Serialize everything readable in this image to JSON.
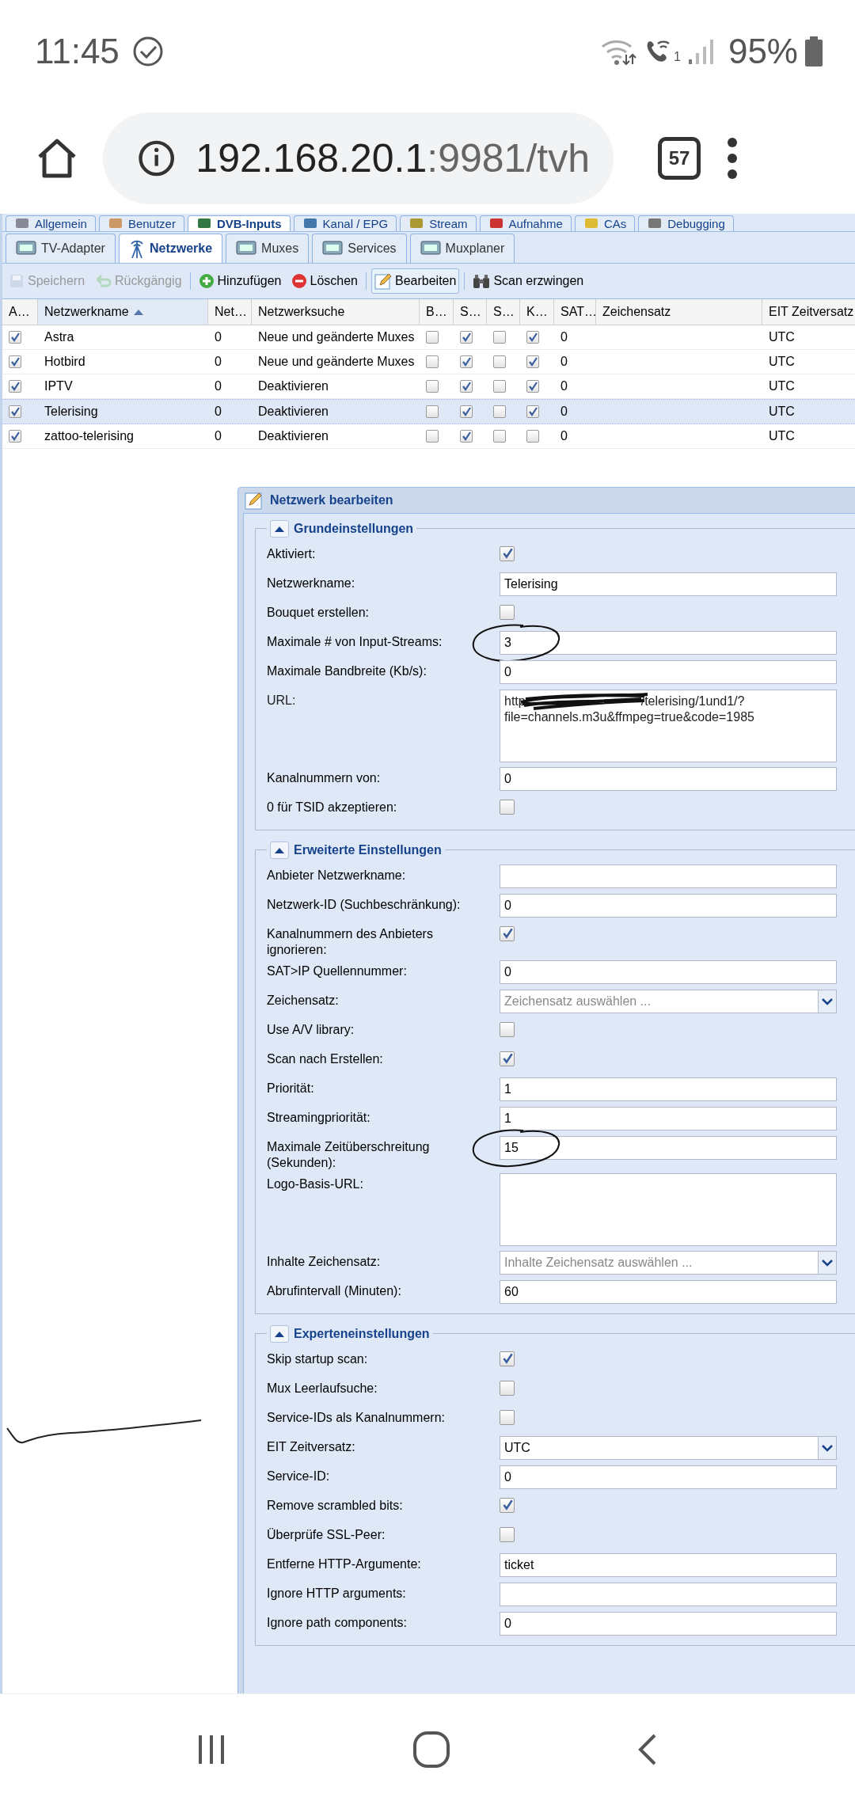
{
  "status_bar": {
    "time": "11:45",
    "sim_label": "1",
    "battery": "95%"
  },
  "browser": {
    "url_host": "192.168.20.1",
    "url_rest": ":9981/tvh",
    "tab_count": "57"
  },
  "main_tabs": [
    {
      "label": "Allgemein",
      "selected": false
    },
    {
      "label": "Benutzer",
      "selected": false
    },
    {
      "label": "DVB-Inputs",
      "selected": true
    },
    {
      "label": "Kanal / EPG",
      "selected": false
    },
    {
      "label": "Stream",
      "selected": false
    },
    {
      "label": "Aufnahme",
      "selected": false
    },
    {
      "label": "CAs",
      "selected": false
    },
    {
      "label": "Debugging",
      "selected": false
    }
  ],
  "sub_tabs": [
    {
      "label": "TV-Adapter",
      "selected": false
    },
    {
      "label": "Netzwerke",
      "selected": true
    },
    {
      "label": "Muxes",
      "selected": false
    },
    {
      "label": "Services",
      "selected": false
    },
    {
      "label": "Muxplaner",
      "selected": false
    }
  ],
  "toolbar": [
    {
      "label": "Speichern",
      "disabled": true,
      "pressed": false
    },
    {
      "label": "Rückgängig",
      "disabled": true,
      "pressed": false
    },
    {
      "label": "Hinzufügen",
      "disabled": false,
      "pressed": false
    },
    {
      "label": "Löschen",
      "disabled": false,
      "pressed": false
    },
    {
      "label": "Bearbeiten",
      "disabled": false,
      "pressed": true
    },
    {
      "label": "Scan erzwingen",
      "disabled": false,
      "pressed": false
    }
  ],
  "table": {
    "columns": [
      {
        "label": "A…",
        "kind": "check",
        "sorted": false
      },
      {
        "label": "Netzwerkname",
        "kind": "text",
        "sorted": true
      },
      {
        "label": "Net…",
        "kind": "text",
        "sorted": false
      },
      {
        "label": "Netzwerksuche",
        "kind": "text",
        "sorted": false
      },
      {
        "label": "B…",
        "kind": "check",
        "sorted": false
      },
      {
        "label": "S…",
        "kind": "check",
        "sorted": false
      },
      {
        "label": "S…",
        "kind": "check",
        "sorted": false
      },
      {
        "label": "K…",
        "kind": "check",
        "sorted": false
      },
      {
        "label": "SAT…",
        "kind": "text",
        "sorted": false
      },
      {
        "label": "Zeichensatz",
        "kind": "text",
        "sorted": false
      },
      {
        "label": "EIT Zeitversatz",
        "kind": "text",
        "sorted": false
      }
    ],
    "rows": [
      {
        "selected": false,
        "cells": [
          {
            "checked": true
          },
          {
            "text": "Astra"
          },
          {
            "text": "0"
          },
          {
            "text": "Neue und geänderte Muxes"
          },
          {
            "checked": false
          },
          {
            "checked": true
          },
          {
            "checked": false
          },
          {
            "checked": true
          },
          {
            "text": "0"
          },
          {},
          {
            "text": "UTC"
          }
        ]
      },
      {
        "selected": false,
        "cells": [
          {
            "checked": true
          },
          {
            "text": "Hotbird"
          },
          {
            "text": "0"
          },
          {
            "text": "Neue und geänderte Muxes"
          },
          {
            "checked": false
          },
          {
            "checked": true
          },
          {
            "checked": false
          },
          {
            "checked": true
          },
          {
            "text": "0"
          },
          {},
          {
            "text": "UTC"
          }
        ]
      },
      {
        "selected": false,
        "cells": [
          {
            "checked": true
          },
          {
            "text": "IPTV"
          },
          {
            "text": "0"
          },
          {
            "text": "Deaktivieren"
          },
          {
            "checked": false
          },
          {
            "checked": true
          },
          {
            "checked": false
          },
          {
            "checked": true
          },
          {
            "text": "0"
          },
          {},
          {
            "text": "UTC"
          }
        ]
      },
      {
        "selected": true,
        "cells": [
          {
            "checked": true
          },
          {
            "text": "Telerising"
          },
          {
            "text": "0"
          },
          {
            "text": "Deaktivieren"
          },
          {
            "checked": false
          },
          {
            "checked": true
          },
          {
            "checked": false
          },
          {
            "checked": true
          },
          {
            "text": "0"
          },
          {},
          {
            "text": "UTC"
          }
        ]
      },
      {
        "selected": false,
        "cells": [
          {
            "checked": true
          },
          {
            "text": "zattoo-telerising"
          },
          {
            "text": "0"
          },
          {
            "text": "Deaktivieren"
          },
          {
            "checked": false
          },
          {
            "checked": true
          },
          {
            "checked": false
          },
          {
            "checked": false
          },
          {
            "text": "0"
          },
          {},
          {
            "text": "UTC"
          }
        ]
      }
    ]
  },
  "edit_window": {
    "title": "Netzwerk bearbeiten",
    "sections": [
      {
        "title": "Grundeinstellungen",
        "expanded": true,
        "fields": [
          {
            "kind": "checkbox",
            "label": "Aktiviert:",
            "checked": true
          },
          {
            "kind": "text",
            "label": "Netzwerkname:",
            "value": "Telerising"
          },
          {
            "kind": "checkbox",
            "label": "Bouquet erstellen:",
            "checked": false
          },
          {
            "kind": "text",
            "label": "Maximale # von Input-Streams:",
            "value": "3",
            "circled": true
          },
          {
            "kind": "text",
            "label": "Maximale Bandbreite (Kb/s):",
            "value": "0"
          },
          {
            "kind": "url",
            "label": "URL:",
            "value_parts": [
              "http",
              "/telerising/1und1/?",
              "file=channels.m3u&ffmpeg=true&code=1985"
            ]
          },
          {
            "kind": "text",
            "label": "Kanalnummern von:",
            "value": "0"
          },
          {
            "kind": "checkbox",
            "label": "0 für TSID akzeptieren:",
            "checked": false
          }
        ]
      },
      {
        "title": "Erweiterte Einstellungen",
        "expanded": true,
        "fields": [
          {
            "kind": "text",
            "label": "Anbieter Netzwerkname:"
          },
          {
            "kind": "text",
            "label": "Netzwerk-ID (Suchbeschränkung):",
            "value": "0"
          },
          {
            "kind": "checkbox",
            "label": "Kanalnummern des Anbieters ignorieren:",
            "checked": true
          },
          {
            "kind": "text",
            "label": "SAT>IP Quellennummer:",
            "value": "0"
          },
          {
            "kind": "select",
            "label": "Zeichensatz:",
            "placeholder": "Zeichensatz auswählen ..."
          },
          {
            "kind": "checkbox",
            "label": "Use A/V library:",
            "checked": false
          },
          {
            "kind": "checkbox",
            "label": "Scan nach Erstellen:",
            "checked": true
          },
          {
            "kind": "text",
            "label": "Priorität:",
            "value": "1"
          },
          {
            "kind": "text",
            "label": "Streamingpriorität:",
            "value": "1"
          },
          {
            "kind": "text",
            "label": "Maximale Zeitüberschreitung (Sekunden):",
            "value": "15",
            "circled": true
          },
          {
            "kind": "textarea",
            "label": "Logo-Basis-URL:"
          },
          {
            "kind": "select",
            "label": "Inhalte Zeichensatz:",
            "placeholder": "Inhalte Zeichensatz auswählen ..."
          },
          {
            "kind": "text",
            "label": "Abrufintervall (Minuten):",
            "value": "60"
          }
        ]
      },
      {
        "title": "Experteneinstellungen",
        "expanded": true,
        "fields": [
          {
            "kind": "checkbox",
            "label": "Skip startup scan:",
            "checked": true
          },
          {
            "kind": "checkbox",
            "label": "Mux Leerlaufsuche:",
            "checked": false
          },
          {
            "kind": "checkbox",
            "label": "Service-IDs als Kanalnummern:",
            "checked": false
          },
          {
            "kind": "select",
            "label": "EIT Zeitversatz:",
            "value": "UTC"
          },
          {
            "kind": "text",
            "label": "Service-ID:",
            "value": "0"
          },
          {
            "kind": "checkbox",
            "label": "Remove scrambled bits:",
            "checked": true
          },
          {
            "kind": "checkbox",
            "label": "Überprüfe SSL-Peer:",
            "checked": false
          },
          {
            "kind": "text",
            "label": "Entferne HTTP-Argumente:",
            "value": "ticket"
          },
          {
            "kind": "text",
            "label": "Ignore HTTP arguments:"
          },
          {
            "kind": "text",
            "label": "Ignore path components:",
            "value": "0"
          }
        ]
      }
    ]
  }
}
